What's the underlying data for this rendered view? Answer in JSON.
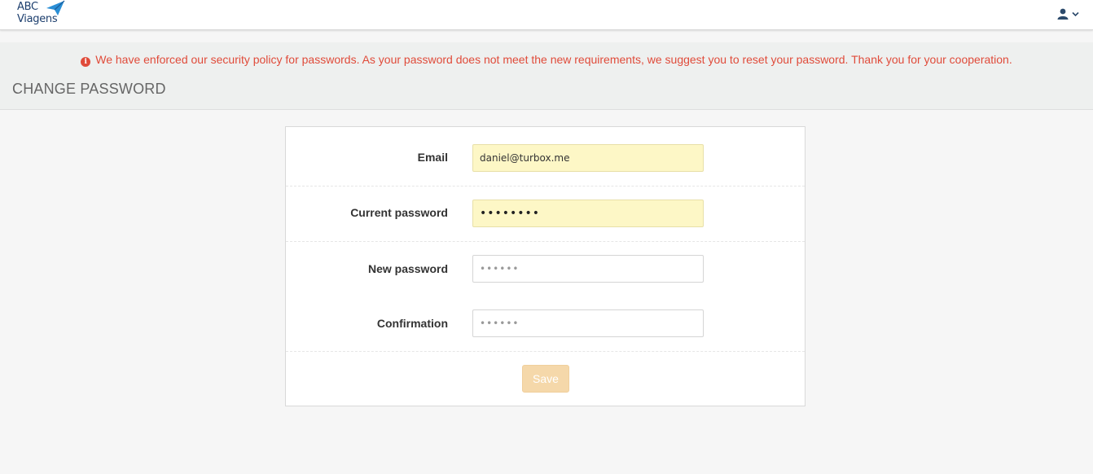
{
  "brand": {
    "line1": "ABC",
    "line2": "Viagens",
    "color": "#1d3f6e",
    "plane_color": "#2a8fd6",
    "logo_icon": "paper-plane-icon"
  },
  "header": {
    "user_icon": "user-icon",
    "dropdown_icon": "chevron-down-icon"
  },
  "alert": {
    "icon": "info-circle-icon",
    "text": "We have enforced our security policy for passwords. As your password does not meet the new requirements, we suggest you to reset your password. Thank you for your cooperation.",
    "color": "#e04b3a"
  },
  "page": {
    "title": "CHANGE PASSWORD"
  },
  "form": {
    "email": {
      "label": "Email",
      "value": "daniel@turbox.me"
    },
    "current_password": {
      "label": "Current password",
      "value": "••••••••"
    },
    "new_password": {
      "label": "New password",
      "placeholder": "••••••"
    },
    "confirmation": {
      "label": "Confirmation",
      "placeholder": "••••••"
    },
    "save_label": "Save",
    "save_color": "#f5d8aa"
  }
}
